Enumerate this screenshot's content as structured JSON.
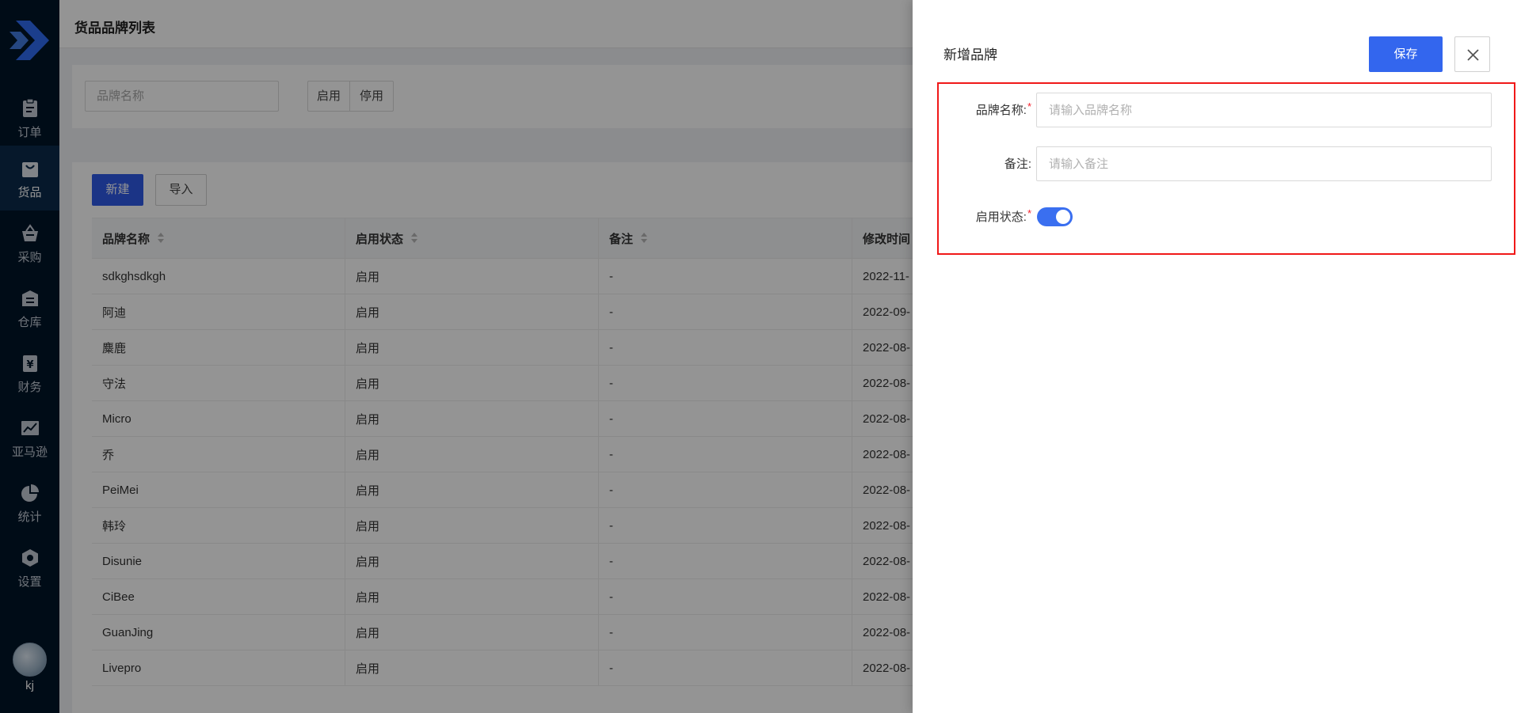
{
  "app": {
    "page_title": "货品品牌列表",
    "user_name": "kj"
  },
  "sidebar": {
    "items": [
      {
        "label": "订单",
        "icon": "clipboard-icon"
      },
      {
        "label": "货品",
        "icon": "shopping-bag-icon"
      },
      {
        "label": "采购",
        "icon": "basket-icon"
      },
      {
        "label": "仓库",
        "icon": "warehouse-icon"
      },
      {
        "label": "财务",
        "icon": "yuan-icon"
      },
      {
        "label": "亚马逊",
        "icon": "trend-chart-icon"
      },
      {
        "label": "统计",
        "icon": "pie-chart-icon"
      },
      {
        "label": "设置",
        "icon": "hexagon-gear-icon"
      }
    ],
    "active": "货品"
  },
  "filters": {
    "brand_name_placeholder": "品牌名称",
    "enabled_label": "启用",
    "disabled_label": "停用"
  },
  "toolbar": {
    "new_label": "新建",
    "import_label": "导入"
  },
  "table": {
    "columns": [
      "品牌名称",
      "启用状态",
      "备注",
      "修改时间"
    ],
    "rows": [
      {
        "name": "sdkghsdkgh",
        "status": "启用",
        "remark": "-",
        "modified": "2022-11-"
      },
      {
        "name": "阿迪",
        "status": "启用",
        "remark": "-",
        "modified": "2022-09-"
      },
      {
        "name": "麋鹿",
        "status": "启用",
        "remark": "-",
        "modified": "2022-08-"
      },
      {
        "name": "守法",
        "status": "启用",
        "remark": "-",
        "modified": "2022-08-"
      },
      {
        "name": "Micro",
        "status": "启用",
        "remark": "-",
        "modified": "2022-08-"
      },
      {
        "name": "乔",
        "status": "启用",
        "remark": "-",
        "modified": "2022-08-"
      },
      {
        "name": "PeiMei",
        "status": "启用",
        "remark": "-",
        "modified": "2022-08-"
      },
      {
        "name": "韩玲",
        "status": "启用",
        "remark": "-",
        "modified": "2022-08-"
      },
      {
        "name": "Disunie",
        "status": "启用",
        "remark": "-",
        "modified": "2022-08-"
      },
      {
        "name": "CiBee",
        "status": "启用",
        "remark": "-",
        "modified": "2022-08-"
      },
      {
        "name": "GuanJing",
        "status": "启用",
        "remark": "-",
        "modified": "2022-08-"
      },
      {
        "name": "Livepro",
        "status": "启用",
        "remark": "-",
        "modified": "2022-08-"
      }
    ]
  },
  "drawer": {
    "title": "新增品牌",
    "save_label": "保存",
    "fields": {
      "brand_name_label": "品牌名称:",
      "brand_name_placeholder": "请输入品牌名称",
      "remark_label": "备注:",
      "remark_placeholder": "请输入备注",
      "status_label": "启用状态:",
      "required_mark": "*"
    },
    "status_enabled": true
  },
  "colors": {
    "sidebar_bg": "#001529",
    "primary": "#3366ee",
    "highlight_border": "#f01818",
    "switch_on": "#3a6ff0"
  }
}
